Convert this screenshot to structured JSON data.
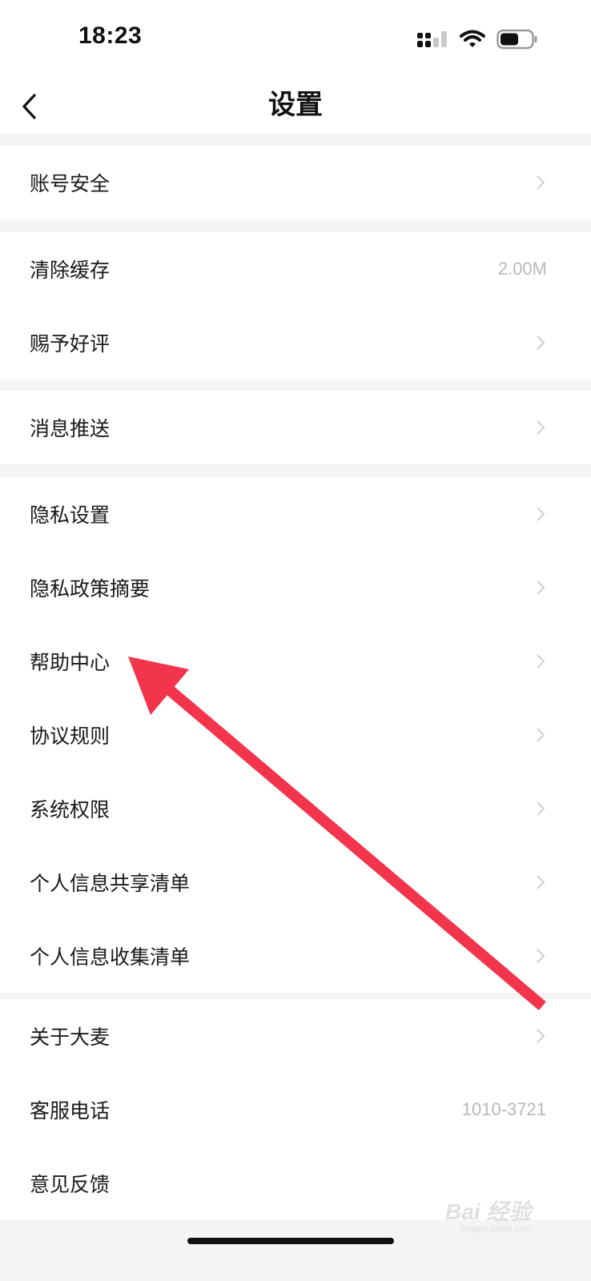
{
  "status_bar": {
    "time": "18:23"
  },
  "header": {
    "title": "设置",
    "back_icon": "chevron-left-icon"
  },
  "sections": [
    {
      "items": [
        {
          "label": "账号安全",
          "value": null,
          "chevron": true
        }
      ]
    },
    {
      "items": [
        {
          "label": "清除缓存",
          "value": "2.00M",
          "chevron": false
        },
        {
          "label": "赐予好评",
          "value": null,
          "chevron": true
        }
      ]
    },
    {
      "items": [
        {
          "label": "消息推送",
          "value": null,
          "chevron": true
        }
      ]
    },
    {
      "items": [
        {
          "label": "隐私设置",
          "value": null,
          "chevron": true
        },
        {
          "label": "隐私政策摘要",
          "value": null,
          "chevron": true
        },
        {
          "label": "帮助中心",
          "value": null,
          "chevron": true
        },
        {
          "label": "协议规则",
          "value": null,
          "chevron": true
        },
        {
          "label": "系统权限",
          "value": null,
          "chevron": true
        },
        {
          "label": "个人信息共享清单",
          "value": null,
          "chevron": true
        },
        {
          "label": "个人信息收集清单",
          "value": null,
          "chevron": true
        }
      ]
    },
    {
      "items": [
        {
          "label": "关于大麦",
          "value": null,
          "chevron": true
        },
        {
          "label": "客服电话",
          "value": "1010-3721",
          "chevron": false
        },
        {
          "label": "意见反馈",
          "value": null,
          "chevron": false
        }
      ]
    }
  ],
  "watermark": {
    "brand": "Bai 经验",
    "url": "jingyan.baidu.com"
  },
  "colors": {
    "background": "#f4f4f4",
    "surface": "#ffffff",
    "annotation_arrow": "#f2344d",
    "secondary_text": "#b8b8b8"
  }
}
